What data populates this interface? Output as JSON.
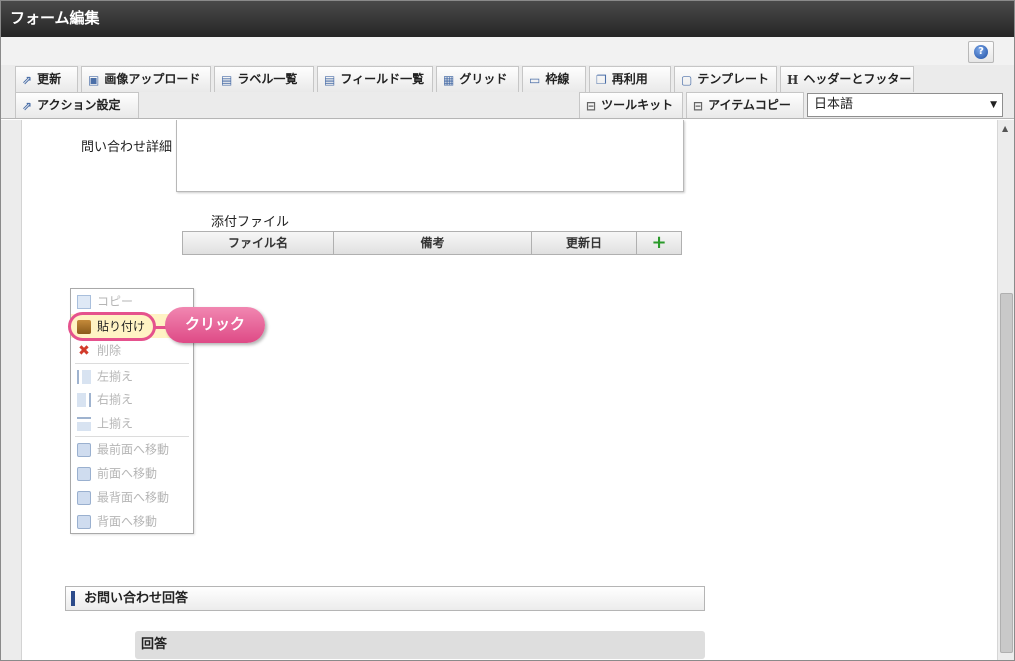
{
  "window": {
    "title": "フォーム編集"
  },
  "help": {
    "icon_glyph": "?"
  },
  "toolbar": {
    "tabs_row1": [
      {
        "label": "更新",
        "icon": "update-icon",
        "glyph": "⇗"
      },
      {
        "label": "画像アップロード",
        "icon": "image-upload-icon",
        "glyph": "▣"
      },
      {
        "label": "ラベル一覧",
        "icon": "label-list-icon",
        "glyph": "▤"
      },
      {
        "label": "フィールド一覧",
        "icon": "field-list-icon",
        "glyph": "▤"
      },
      {
        "label": "グリッド",
        "icon": "grid-icon",
        "glyph": "▦"
      },
      {
        "label": "枠線",
        "icon": "border-icon",
        "glyph": "▭"
      },
      {
        "label": "再利用",
        "icon": "reuse-icon",
        "glyph": "❐"
      },
      {
        "label": "テンプレート",
        "icon": "template-icon",
        "glyph": "▢"
      },
      {
        "label": "ヘッダーとフッター",
        "icon": "header-footer-icon",
        "glyph": "H"
      }
    ],
    "tabs_row2_left": [
      {
        "label": "アクション設定",
        "icon": "action-settings-icon",
        "glyph": "⇗"
      }
    ],
    "tabs_row2_right": [
      {
        "label": "ツールキット",
        "icon": "toolkit-icon",
        "glyph": "⊟"
      },
      {
        "label": "アイテムコピー",
        "icon": "item-copy-icon",
        "glyph": "⊟"
      }
    ],
    "language": {
      "selected": "日本語",
      "arrow": "▼"
    }
  },
  "form": {
    "detail_label": "問い合わせ詳細",
    "attach_label": "添付ファイル",
    "attach_columns": [
      "ファイル名",
      "備考",
      "更新日"
    ],
    "attach_add": "+",
    "section_title": "お問い合わせ回答",
    "answer_label": "回答"
  },
  "context_menu": {
    "items": [
      {
        "label": "コピー",
        "icon": "copy-icon",
        "enabled": false
      },
      {
        "label": "貼り付け",
        "icon": "paste-icon",
        "enabled": true,
        "highlight": true
      },
      {
        "label": "削除",
        "icon": "delete-icon",
        "enabled": false
      },
      {
        "label": "左揃え",
        "icon": "align-left-icon",
        "enabled": false
      },
      {
        "label": "右揃え",
        "icon": "align-right-icon",
        "enabled": false
      },
      {
        "label": "上揃え",
        "icon": "align-top-icon",
        "enabled": false
      },
      {
        "label": "最前面へ移動",
        "icon": "bring-to-front-icon",
        "enabled": false
      },
      {
        "label": "前面へ移動",
        "icon": "bring-forward-icon",
        "enabled": false
      },
      {
        "label": "最背面へ移動",
        "icon": "send-to-back-icon",
        "enabled": false
      },
      {
        "label": "背面へ移動",
        "icon": "send-backward-icon",
        "enabled": false
      }
    ],
    "delete_glyph": "✖"
  },
  "callout": {
    "label": "クリック"
  },
  "scrollbar": {
    "up_arrow": "▲"
  },
  "colors": {
    "accent_pink": "#e5528d",
    "title_bar": "#2e2e2e",
    "section_marker": "#2c4b8a",
    "add_green": "#2a9a2a"
  }
}
